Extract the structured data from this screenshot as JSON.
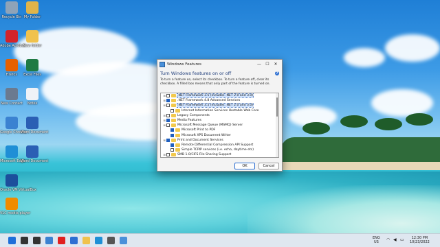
{
  "desktop": {
    "icons": [
      {
        "label": "Recycle Bin",
        "icon": "recycle-bin-icon",
        "color": "#8fa3b8"
      },
      {
        "label": "My Folder",
        "icon": "home-folder-icon",
        "color": "#e0b44a"
      },
      {
        "label": "Adobe Acrobat",
        "icon": "acrobat-icon",
        "color": "#d3232a"
      },
      {
        "label": "New folder",
        "icon": "folder-icon",
        "color": "#f0c24d"
      },
      {
        "label": "Firefox",
        "icon": "firefox-icon",
        "color": "#e66000"
      },
      {
        "label": "Excel Files",
        "icon": "excel-icon",
        "color": "#1f7a44"
      },
      {
        "label": "New Contact",
        "icon": "contact-card-icon",
        "color": "#6b7a8f"
      },
      {
        "label": "Notes",
        "icon": "document-icon",
        "color": "#eef2f7"
      },
      {
        "label": "Google Chrome",
        "icon": "chrome-icon",
        "color": "#3b82d1"
      },
      {
        "label": "Word Document",
        "icon": "word-icon",
        "color": "#2b5fb4"
      },
      {
        "label": "Microsoft Edge",
        "icon": "edge-icon",
        "color": "#1f8fd6"
      },
      {
        "label": "Word Document",
        "icon": "word-icon",
        "color": "#2b5fb4"
      },
      {
        "label": "Oracle VM VirtualBox",
        "icon": "virtualbox-icon",
        "color": "#1c4f9c"
      },
      {
        "label": "VLC media player",
        "icon": "vlc-icon",
        "color": "#f08c00"
      }
    ]
  },
  "window": {
    "title": "Windows Features",
    "minimize": "—",
    "maximize": "☐",
    "close": "✕",
    "heading": "Turn Windows features on or off",
    "help": "?",
    "description": "To turn a feature on, select its checkbox. To turn a feature off, clear its checkbox. A filled box means that only part of the feature is turned on.",
    "features": [
      {
        "label": ".NET Framework 3.5 (includes .NET 2.0 and 3.0)",
        "state": "partial",
        "expandable": true,
        "indent": 0,
        "selected": true
      },
      {
        "label": ".NET Framework 4.8 Advanced Services",
        "state": "filled",
        "expandable": true,
        "indent": 0,
        "selected": false
      },
      {
        "label": ".NET Framework 3.5 (includes .NET 2.0 and 3.0)",
        "state": "empty",
        "expandable": true,
        "indent": 0,
        "selected": true
      },
      {
        "label": "Internet Information Services Hostable Web Core",
        "state": "empty",
        "expandable": false,
        "indent": 1,
        "selected": false
      },
      {
        "label": "Legacy Components",
        "state": "empty",
        "expandable": true,
        "indent": 0,
        "selected": false
      },
      {
        "label": "Media Features",
        "state": "filled",
        "expandable": true,
        "indent": 0,
        "selected": false
      },
      {
        "label": "Microsoft Message Queue (MSMQ) Server",
        "state": "empty",
        "expandable": true,
        "indent": 0,
        "selected": false
      },
      {
        "label": "Microsoft Print to PDF",
        "state": "filled",
        "expandable": false,
        "indent": 1,
        "selected": false
      },
      {
        "label": "Microsoft XPS Document Writer",
        "state": "filled",
        "expandable": false,
        "indent": 1,
        "selected": false
      },
      {
        "label": "Print and Document Services",
        "state": "filled",
        "expandable": true,
        "indent": 0,
        "selected": false
      },
      {
        "label": "Remote Differential Compression API Support",
        "state": "filled",
        "expandable": false,
        "indent": 1,
        "selected": false
      },
      {
        "label": "Simple TCPIP services (i.e. echo, daytime etc)",
        "state": "empty",
        "expandable": false,
        "indent": 1,
        "selected": false
      },
      {
        "label": "SMB 1.0/CIFS File Sharing Support",
        "state": "empty",
        "expandable": true,
        "indent": 0,
        "selected": false
      }
    ],
    "ok_label": "OK",
    "cancel_label": "Cancel"
  },
  "taskbar": {
    "apps": [
      {
        "name": "start-icon",
        "color": "#1e6fd9"
      },
      {
        "name": "search-icon",
        "color": "#333333"
      },
      {
        "name": "task-view-icon",
        "color": "#333333"
      },
      {
        "name": "chrome-icon",
        "color": "#3b82d1"
      },
      {
        "name": "youtube-icon",
        "color": "#e02020"
      },
      {
        "name": "mail-icon",
        "color": "#2d6fd2"
      },
      {
        "name": "file-explorer-icon",
        "color": "#f0c24d"
      },
      {
        "name": "edge-icon",
        "color": "#1f8fd6"
      },
      {
        "name": "settings-icon",
        "color": "#555555"
      },
      {
        "name": "windows-features-icon",
        "color": "#4a90d9"
      }
    ],
    "language": "ENG",
    "region": "US",
    "time": "12:30 PM",
    "date": "10/23/2022"
  }
}
